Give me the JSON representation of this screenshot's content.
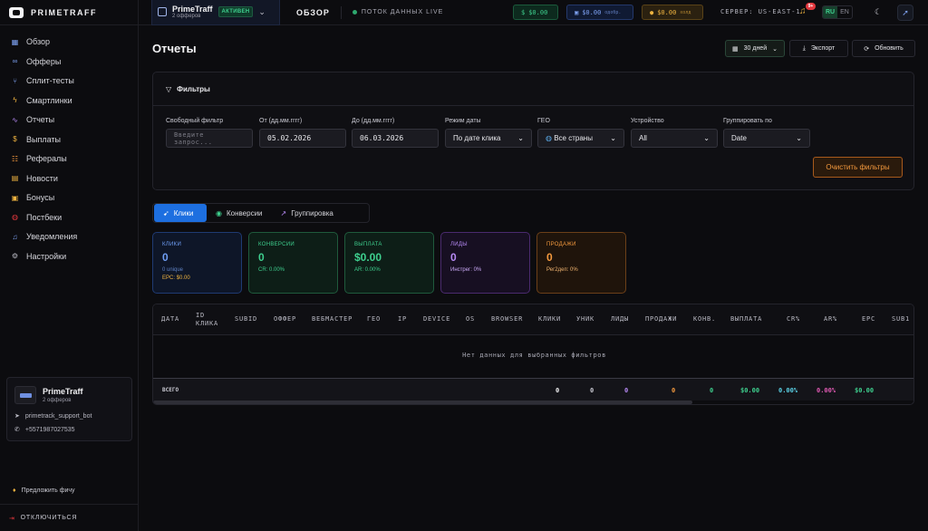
{
  "topbar": {
    "logo": "PRIMETRAFF",
    "account_name": "PrimeTraff",
    "account_sub": "2 офферов",
    "account_status": "АКТИВЕН",
    "title": "ОБЗОР",
    "live": "ПОТОК ДАННЫХ LIVE",
    "bal_green": "$0.00",
    "bal_blue": "$0.00",
    "bal_blue_note": "одобр.",
    "bal_yellow": "$0.00",
    "bal_yellow_note": "холд",
    "server": "СЕРВЕР: US-EAST-1",
    "notif_badge": "9+",
    "lang_ru": "RU",
    "lang_en": "EN"
  },
  "sidebar": {
    "items": [
      {
        "label": "Обзор",
        "icon": "grid-icon",
        "color": "#7fa3f5"
      },
      {
        "label": "Офферы",
        "icon": "link-icon",
        "color": "#7fa3f5"
      },
      {
        "label": "Сплит-тесты",
        "icon": "split-icon",
        "color": "#7fa3f5"
      },
      {
        "label": "Смартлинки",
        "icon": "bolt-icon",
        "color": "#f0b440"
      },
      {
        "label": "Отчеты",
        "icon": "chart-icon",
        "color": "#b78af5"
      },
      {
        "label": "Выплаты",
        "icon": "dollar-icon",
        "color": "#f0b440"
      },
      {
        "label": "Рефералы",
        "icon": "users-icon",
        "color": "#f59a3e"
      },
      {
        "label": "Новости",
        "icon": "news-icon",
        "color": "#f0b440"
      },
      {
        "label": "Бонусы",
        "icon": "gift-icon",
        "color": "#f0b440"
      },
      {
        "label": "Постбеки",
        "icon": "globe-icon",
        "color": "#e2373d"
      },
      {
        "label": "Уведомления",
        "icon": "bell-icon",
        "color": "#7fa3f5"
      },
      {
        "label": "Настройки",
        "icon": "gear-icon",
        "color": "#b9b9c3"
      }
    ],
    "promo_name": "PrimeTraff",
    "promo_sub": "2 офферов",
    "promo_bot": "primetrack_support_bot",
    "promo_phone": "+5571987027535",
    "suggest": "Предложить фичу",
    "logout": "ОТКЛЮЧИТЬСЯ"
  },
  "main": {
    "title": "Отчеты",
    "days": "30 дней",
    "export": "Экспорт",
    "refresh": "Обновить",
    "filters_title": "Фильтры",
    "f_free_label": "Свободный фильтр",
    "f_free_placeholder": "Введите запрос...",
    "f_from_label": "От (дд.мм.гггг)",
    "f_from": "05.02.2026",
    "f_to_label": "До (дд.мм.гггг)",
    "f_to": "06.03.2026",
    "f_mode_label": "Режим даты",
    "f_mode": "По дате клика",
    "f_geo_label": "ГЕО",
    "f_geo": "Все страны",
    "f_device_label": "Устройство",
    "f_device": "All",
    "f_group_label": "Группировать по",
    "f_group": "Date",
    "clear": "Очистить фильтры",
    "tab_clicks": "Клики",
    "tab_conv": "Конверсии",
    "tab_group": "Группировка"
  },
  "cards": {
    "clicks_k": "КЛИКИ",
    "clicks_v": "0",
    "clicks_s1": "0 unique",
    "clicks_s2": "EPC: $0.00",
    "conv_k": "КОНВЕРСИИ",
    "conv_v": "0",
    "conv_s": "CR: 0.00%",
    "pay_k": "ВЫПЛАТА",
    "pay_v": "$0.00",
    "pay_s": "AR: 0.00%",
    "leads_k": "ЛИДЫ",
    "leads_v": "0",
    "leads_s": "Инстрег: 0%",
    "sales_k": "ПРОДАЖИ",
    "sales_v": "0",
    "sales_s": "Рег2деп: 0%"
  },
  "table": {
    "headers": [
      "ДАТА",
      "ID КЛИКА",
      "SUBID",
      "ОФФЕР",
      "ВЕБМАСТЕР",
      "ГЕО",
      "IP",
      "DEVICE",
      "OS",
      "BROWSER",
      "КЛИКИ",
      "УНИК",
      "ЛИДЫ",
      "ПРОДАЖИ",
      "КОНВ.",
      "ВЫПЛАТА",
      "CR%",
      "AR%",
      "EPC",
      "SUB1"
    ],
    "empty": "Нет данных для выбранных фильтров",
    "total_label": "ВСЕГО",
    "totals": [
      "0",
      "0",
      "0",
      "0",
      "0",
      "$0.00",
      "0.00%",
      "0.00%",
      "$0.00"
    ]
  }
}
